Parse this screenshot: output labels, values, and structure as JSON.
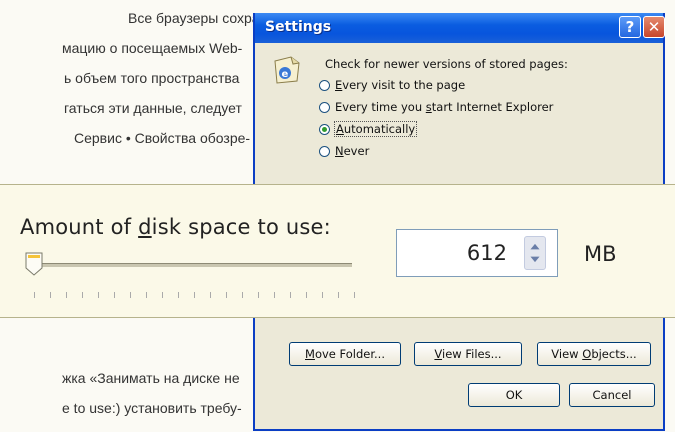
{
  "article": {
    "lines": [
      "Все браузеры сохраняют",
      "мацию о посещаемых Web-",
      "ь объем того пространства",
      "гаться эти данные, следует",
      "Сервис • Свойства обозре-",
      "жка «Занимать на диске не",
      "e to use:) установить требу-"
    ]
  },
  "dialog": {
    "title": "Settings",
    "help_glyph": "?",
    "close_glyph": "✕",
    "group_label": "Check for newer versions of stored pages:",
    "options": [
      {
        "pre": "",
        "key": "E",
        "post": "very visit to the page",
        "checked": false
      },
      {
        "pre": "Every time you ",
        "key": "s",
        "post": "tart Internet Explorer",
        "checked": false
      },
      {
        "pre": "",
        "key": "A",
        "post": "utomatically",
        "checked": true
      },
      {
        "pre": "",
        "key": "N",
        "post": "ever",
        "checked": false
      }
    ],
    "disk_space": {
      "label_pre": "Amount of ",
      "label_key": "d",
      "label_post": "isk space to use:",
      "value": "612",
      "unit": "MB"
    },
    "buttons": {
      "move_folder": {
        "key": "M",
        "rest": "ove Folder..."
      },
      "view_files": {
        "key": "V",
        "rest": "iew Files..."
      },
      "view_objects_pre": "View ",
      "view_objects_key": "O",
      "view_objects_post": "bjects...",
      "ok": "OK",
      "cancel": "Cancel"
    }
  }
}
